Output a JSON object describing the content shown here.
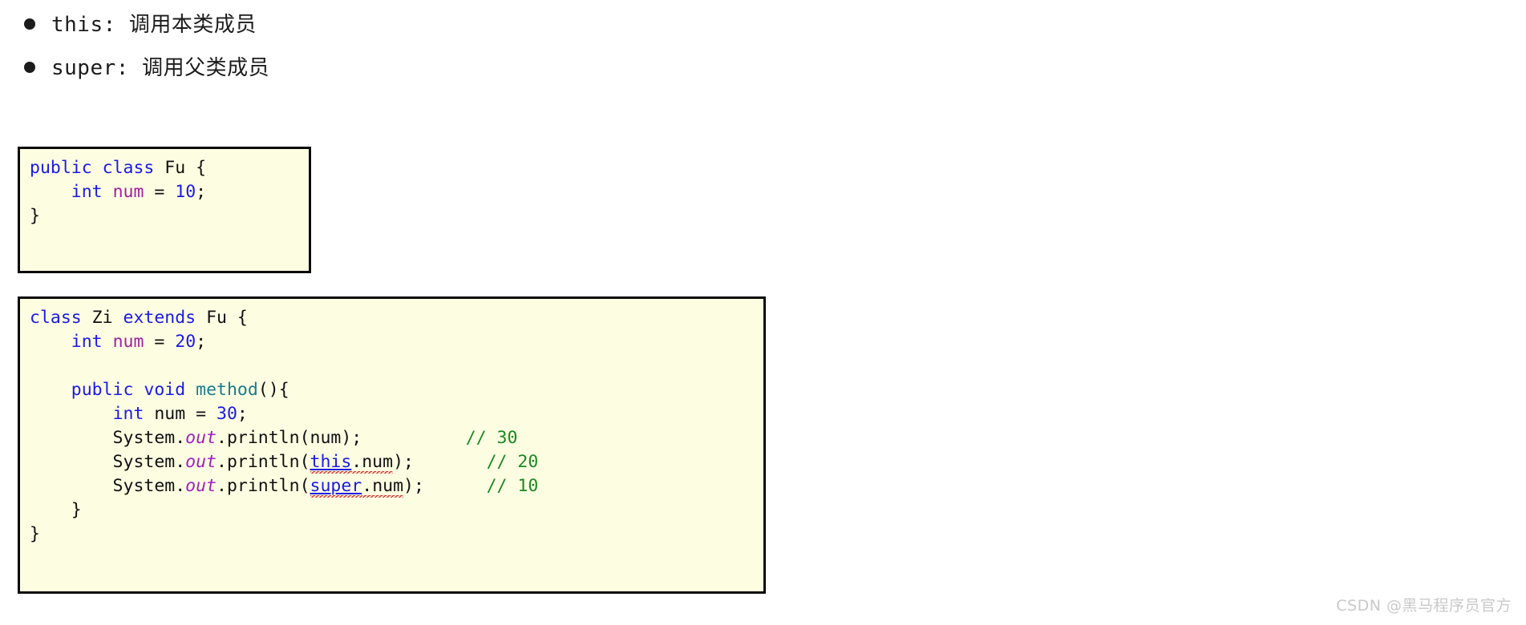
{
  "slide": {
    "bullets": [
      {
        "text": "this: 调用本类成员"
      },
      {
        "text": "super: 调用父类成员"
      }
    ],
    "code_blocks": [
      {
        "name": "fu-class",
        "lines": [
          {
            "tokens": [
              {
                "t": "public",
                "c": "kw"
              },
              {
                "t": " ",
                "c": "plain"
              },
              {
                "t": "class",
                "c": "kw"
              },
              {
                "t": " Fu {",
                "c": "plain"
              }
            ]
          },
          {
            "tokens": [
              {
                "t": "    ",
                "c": "plain"
              },
              {
                "t": "int",
                "c": "kw"
              },
              {
                "t": " ",
                "c": "plain"
              },
              {
                "t": "num",
                "c": "field"
              },
              {
                "t": " = ",
                "c": "plain"
              },
              {
                "t": "10",
                "c": "num-lit"
              },
              {
                "t": ";",
                "c": "plain"
              }
            ]
          },
          {
            "tokens": [
              {
                "t": "}",
                "c": "plain"
              }
            ]
          }
        ]
      },
      {
        "name": "zi-class",
        "lines": [
          {
            "tokens": [
              {
                "t": "class",
                "c": "kw"
              },
              {
                "t": " Zi ",
                "c": "plain"
              },
              {
                "t": "extends",
                "c": "kw"
              },
              {
                "t": " Fu {",
                "c": "plain"
              }
            ]
          },
          {
            "tokens": [
              {
                "t": "    ",
                "c": "plain"
              },
              {
                "t": "int",
                "c": "kw"
              },
              {
                "t": " ",
                "c": "plain"
              },
              {
                "t": "num",
                "c": "field"
              },
              {
                "t": " = ",
                "c": "plain"
              },
              {
                "t": "20",
                "c": "num-lit"
              },
              {
                "t": ";",
                "c": "plain"
              }
            ]
          },
          {
            "tokens": []
          },
          {
            "tokens": [
              {
                "t": "    ",
                "c": "plain"
              },
              {
                "t": "public",
                "c": "kw"
              },
              {
                "t": " ",
                "c": "plain"
              },
              {
                "t": "void",
                "c": "kw"
              },
              {
                "t": " ",
                "c": "plain"
              },
              {
                "t": "method",
                "c": "method"
              },
              {
                "t": "(){",
                "c": "plain"
              }
            ]
          },
          {
            "tokens": [
              {
                "t": "        ",
                "c": "plain"
              },
              {
                "t": "int",
                "c": "kw"
              },
              {
                "t": " num = ",
                "c": "plain"
              },
              {
                "t": "30",
                "c": "num-lit"
              },
              {
                "t": ";",
                "c": "plain"
              }
            ]
          },
          {
            "tokens": [
              {
                "t": "        System.",
                "c": "plain"
              },
              {
                "t": "out",
                "c": "static-it"
              },
              {
                "t": ".println(num);",
                "c": "plain"
              },
              {
                "t": "          ",
                "c": "plain"
              },
              {
                "t": "// 30",
                "c": "comment"
              }
            ]
          },
          {
            "tokens": [
              {
                "t": "        System.",
                "c": "plain"
              },
              {
                "t": "out",
                "c": "static-it"
              },
              {
                "t": ".println(",
                "c": "plain"
              },
              {
                "t": "this",
                "c": "ref squiggly"
              },
              {
                "t": ".num",
                "c": "plain squiggly"
              },
              {
                "t": ");",
                "c": "plain"
              },
              {
                "t": "       ",
                "c": "plain"
              },
              {
                "t": "// 20",
                "c": "comment"
              }
            ]
          },
          {
            "tokens": [
              {
                "t": "        System.",
                "c": "plain"
              },
              {
                "t": "out",
                "c": "static-it"
              },
              {
                "t": ".println(",
                "c": "plain"
              },
              {
                "t": "super",
                "c": "ref squiggly"
              },
              {
                "t": ".num",
                "c": "plain squiggly"
              },
              {
                "t": ");",
                "c": "plain"
              },
              {
                "t": "      ",
                "c": "plain"
              },
              {
                "t": "// 10",
                "c": "comment"
              }
            ]
          },
          {
            "tokens": [
              {
                "t": "    }",
                "c": "plain"
              }
            ]
          },
          {
            "tokens": [
              {
                "t": "}",
                "c": "plain"
              }
            ]
          }
        ]
      }
    ],
    "watermark": "CSDN @黑马程序员官方"
  },
  "colors": {
    "page_background": "#ffffff",
    "code_background": "#fdfde2",
    "code_border": "#0a0a0a",
    "keyword": "#1a1ae8",
    "field": "#a020a0",
    "method": "#197b8c",
    "static_member": "#a020c0",
    "comment": "#1a8a22",
    "spellcheck_underline": "#e03030",
    "text": "#101010",
    "watermark": "#c9c9c9"
  }
}
